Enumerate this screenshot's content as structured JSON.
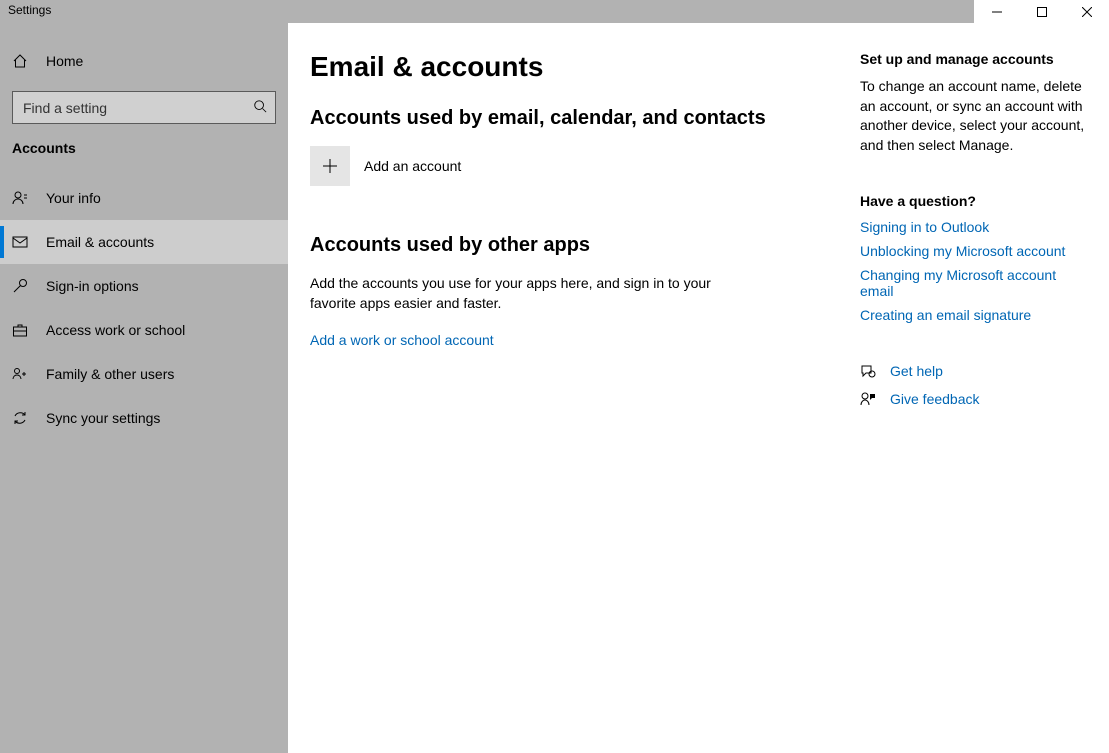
{
  "window": {
    "title": "Settings"
  },
  "sidebar": {
    "home": "Home",
    "search_placeholder": "Find a setting",
    "section": "Accounts",
    "items": [
      {
        "label": "Your info"
      },
      {
        "label": "Email & accounts"
      },
      {
        "label": "Sign-in options"
      },
      {
        "label": "Access work or school"
      },
      {
        "label": "Family & other users"
      },
      {
        "label": "Sync your settings"
      }
    ]
  },
  "page": {
    "title": "Email & accounts",
    "section1_title": "Accounts used by email, calendar, and contacts",
    "add_account": "Add an account",
    "section2_title": "Accounts used by other apps",
    "section2_body": "Add the accounts you use for your apps here, and sign in to your favorite apps easier and faster.",
    "add_work_link": "Add a work or school account"
  },
  "aside": {
    "setup_heading": "Set up and manage accounts",
    "setup_body": "To change an account name, delete an account, or sync an account with another device, select your account, and then select Manage.",
    "question_heading": "Have a question?",
    "links": [
      "Signing in to Outlook",
      "Unblocking my Microsoft account",
      "Changing my Microsoft account email",
      "Creating an email signature"
    ],
    "get_help": "Get help",
    "give_feedback": "Give feedback"
  }
}
